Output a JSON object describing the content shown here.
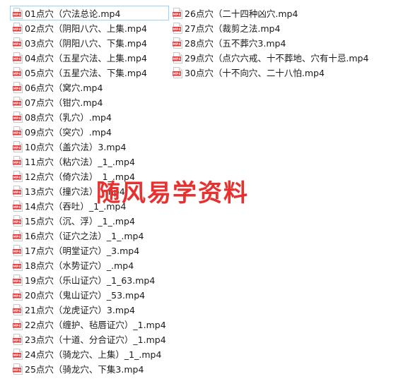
{
  "icon": "mp4-file-icon",
  "icon_label": "MP4",
  "accent": "#e8302f",
  "selection_border": "#99d1ff",
  "watermark": "随风易学资料",
  "files_left": [
    "01点穴（穴法总论.mp4",
    "02点穴（阴阳八穴、上集.mp4",
    "03点穴（阴阳八穴、下集.mp4",
    "04点穴（五星穴法、上集.mp4",
    "05点穴（五星穴法、下集.mp4",
    "06点穴（窝穴.mp4",
    "07点穴（钳穴.mp4",
    "08点穴（乳穴）.mp4",
    "09点穴（突穴）.mp4",
    "10点穴（盖穴法）3.mp4",
    "11点穴（粘穴法）_1_.mp4",
    "12点穴（倚穴法）_1_.mp4",
    "13点穴（撞穴法）_.mp4",
    "14点穴（吞吐）_1_.mp4",
    "15点穴（沉、浮）_1_.mp4",
    "16点穴（证穴之法）_1_.mp4",
    "17点穴（明堂证穴）_3.mp4",
    "18点穴（水势证穴）_.mp4",
    "19点穴（乐山证穴）_1_63.mp4",
    "20点穴（鬼山证穴）_53.mp4",
    "21点穴（龙虎证穴）3.mp4",
    "22点穴（缠护、毡唇证穴）_1.mp4",
    "23点穴（十道、分合证穴）_1.mp4",
    "24点穴（骑龙穴、上集）_1_.mp4",
    "25点穴（骑龙穴、下集3.mp4"
  ],
  "files_right": [
    "26点穴（二十四种凶穴.mp4",
    "27点穴（裁剪之法.mp4",
    "28点穴（五不葬穴3.mp4",
    "29点穴（点穴六戒、十不葬地、穴有十忌.mp4",
    "30点穴（十不向穴、二十八怕.mp4"
  ]
}
